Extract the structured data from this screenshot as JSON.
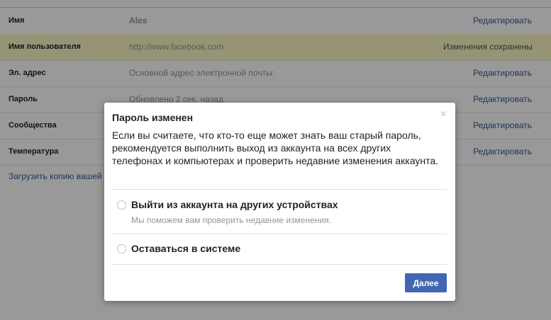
{
  "settings": {
    "rows": [
      {
        "label": "Имя",
        "value": "Ales",
        "action": "Редактировать"
      },
      {
        "label": "Имя пользователя",
        "value": "http://www.facebook.com",
        "action": "Изменения сохранены"
      },
      {
        "label": "Эл. адрес",
        "value": "Основной адрес электронной почты:",
        "action": "Редактировать"
      },
      {
        "label": "Пароль",
        "value": "Обновлено 2 сек. назад",
        "action": "Редактировать"
      },
      {
        "label": "Сообщества",
        "value": "",
        "action": "Редактировать"
      },
      {
        "label": "Температура",
        "value": "",
        "action": "Редактировать"
      }
    ],
    "download_link": "Загрузить копию вашей"
  },
  "dialog": {
    "title": "Пароль изменен",
    "close_glyph": "×",
    "body": "Если вы считаете, что кто-то еще может знать ваш старый пароль, рекомендуется выполнить выход из аккаунта на всех других телефонах и компьютерах и проверить недавние изменения аккаунта.",
    "options": [
      {
        "label": "Выйти из аккаунта на других устройствах",
        "sub": "Мы поможем вам проверить недавние изменения.",
        "selected": false
      },
      {
        "label": "Оставаться в системе",
        "sub": "",
        "selected": false
      }
    ],
    "next_button": "Далее"
  },
  "colors": {
    "link": "#365899",
    "button": "#4267b2",
    "highlight_row": "#fcf7c5",
    "overlay": "rgba(0,0,0,0.40)"
  }
}
